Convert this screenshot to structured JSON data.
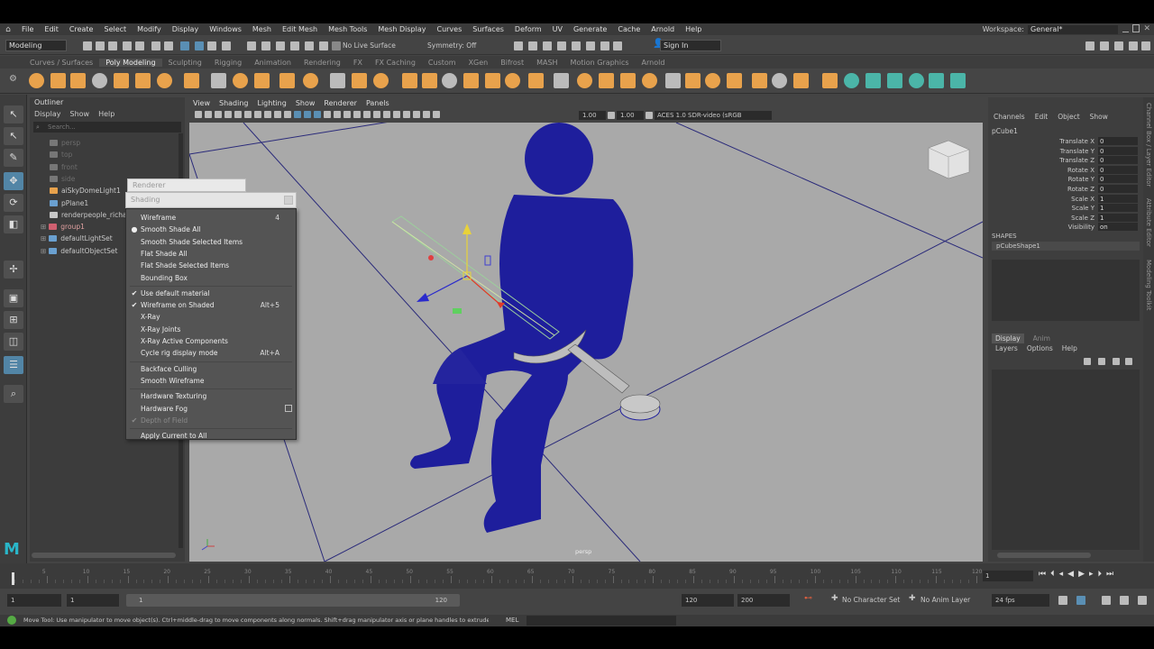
{
  "menubar": {
    "items": [
      "File",
      "Edit",
      "Create",
      "Select",
      "Modify",
      "Display",
      "Windows",
      "Mesh",
      "Edit Mesh",
      "Mesh Tools",
      "Mesh Display",
      "Curves",
      "Surfaces",
      "Deform",
      "UV",
      "Generate",
      "Cache",
      "Arnold",
      "Help"
    ],
    "workspace_label": "Workspace:",
    "workspace_value": "General*"
  },
  "statusline": {
    "mode": "Modeling",
    "live_surface": "No Live Surface",
    "symmetry": "Symmetry: Off",
    "sign_in": "Sign In"
  },
  "shelf": {
    "tabs": [
      "Curves / Surfaces",
      "Poly Modeling",
      "Sculpting",
      "Rigging",
      "Animation",
      "Rendering",
      "FX",
      "FX Caching",
      "Custom",
      "XGen",
      "Bifrost",
      "MASH",
      "Motion Graphics",
      "Arnold"
    ],
    "active_tab": "Poly Modeling",
    "accent_color": "#e8a24c"
  },
  "outliner": {
    "title": "Outliner",
    "menu": [
      "Display",
      "Show",
      "Help"
    ],
    "search_placeholder": "Search...",
    "items": [
      {
        "label": "persp",
        "hidden": true
      },
      {
        "label": "top",
        "hidden": true
      },
      {
        "label": "front",
        "hidden": true
      },
      {
        "label": "side",
        "hidden": true
      },
      {
        "label": "aiSkyDomeLight1",
        "hidden": false
      },
      {
        "label": "pPlane1",
        "hidden": false
      },
      {
        "label": "renderpeople_richar",
        "hidden": false
      },
      {
        "label": "group1",
        "hidden": false,
        "selected": true
      },
      {
        "label": "defaultLightSet",
        "hidden": false
      },
      {
        "label": "defaultObjectSet",
        "hidden": false
      }
    ]
  },
  "viewport": {
    "menu": [
      "View",
      "Shading",
      "Lighting",
      "Show",
      "Renderer",
      "Panels"
    ],
    "exposure": "1.00",
    "gamma": "1.00",
    "color_space": "ACES 1.0 SDR-video (sRGB",
    "camera_label": "persp",
    "mesh_color": "#1e1e9c"
  },
  "popup": {
    "renderer_title": "Renderer",
    "shading_title": "Shading",
    "items": [
      {
        "label": "Wireframe",
        "shortcut": "4",
        "mark": ""
      },
      {
        "label": "Smooth Shade All",
        "shortcut": "",
        "mark": "●"
      },
      {
        "label": "Smooth Shade Selected Items",
        "shortcut": "",
        "mark": ""
      },
      {
        "label": "Flat Shade All",
        "shortcut": "",
        "mark": ""
      },
      {
        "label": "Flat Shade Selected Items",
        "shortcut": "",
        "mark": ""
      },
      {
        "label": "Bounding Box",
        "shortcut": "",
        "mark": ""
      },
      {
        "label": "Use default material",
        "shortcut": "",
        "mark": "✔"
      },
      {
        "label": "Wireframe on Shaded",
        "shortcut": "Alt+5",
        "mark": "✔"
      },
      {
        "label": "X-Ray",
        "shortcut": "",
        "mark": ""
      },
      {
        "label": "X-Ray Joints",
        "shortcut": "",
        "mark": ""
      },
      {
        "label": "X-Ray Active Components",
        "shortcut": "",
        "mark": ""
      },
      {
        "label": "Cycle rig display mode",
        "shortcut": "Alt+A",
        "mark": ""
      },
      {
        "label": "Backface Culling",
        "shortcut": "",
        "mark": ""
      },
      {
        "label": "Smooth Wireframe",
        "shortcut": "",
        "mark": ""
      },
      {
        "label": "Hardware Texturing",
        "shortcut": "",
        "mark": ""
      },
      {
        "label": "Hardware Fog",
        "shortcut": "",
        "mark": ""
      },
      {
        "label": "Depth of Field",
        "shortcut": "",
        "mark": "✔",
        "disabled": true
      },
      {
        "label": "Apply Current to All",
        "shortcut": "",
        "mark": ""
      }
    ]
  },
  "channelbox": {
    "menu": [
      "Channels",
      "Edit",
      "Object",
      "Show"
    ],
    "object": "pCube1",
    "attributes": [
      {
        "label": "Translate X",
        "value": "0"
      },
      {
        "label": "Translate Y",
        "value": "0"
      },
      {
        "label": "Translate Z",
        "value": "0"
      },
      {
        "label": "Rotate X",
        "value": "0"
      },
      {
        "label": "Rotate Y",
        "value": "0"
      },
      {
        "label": "Rotate Z",
        "value": "0"
      },
      {
        "label": "Scale X",
        "value": "1"
      },
      {
        "label": "Scale Y",
        "value": "1"
      },
      {
        "label": "Scale Z",
        "value": "1"
      },
      {
        "label": "Visibility",
        "value": "on"
      }
    ],
    "shapes_header": "SHAPES",
    "shape_name": "pCubeShape1",
    "layer_tabs": [
      "Display",
      "Anim"
    ],
    "layer_menu": [
      "Layers",
      "Options",
      "Help"
    ],
    "side_tabs": [
      "Channel Box / Layer Editor",
      "Attribute Editor",
      "Modeling Toolkit"
    ]
  },
  "timeline": {
    "ticks": [
      "5",
      "10",
      "15",
      "20",
      "25",
      "30",
      "35",
      "40",
      "45",
      "50",
      "55",
      "60",
      "65",
      "70",
      "75",
      "80",
      "85",
      "90",
      "95",
      "100",
      "105",
      "110",
      "115",
      "120"
    ],
    "current_frame": "1",
    "range_start": "1",
    "range_inner_start": "1",
    "range_slider_start": "1",
    "range_slider_end": "120",
    "range_end": "120",
    "anim_end": "200",
    "character_set": "No Character Set",
    "anim_layer": "No Anim Layer",
    "fps": "24 fps"
  },
  "helpline": {
    "text": "Move Tool: Use manipulator to move object(s). Ctrl+middle-drag to move components along normals. Shift+drag manipulator axis or plane handles to extrude components or c",
    "mel_label": "MEL"
  }
}
